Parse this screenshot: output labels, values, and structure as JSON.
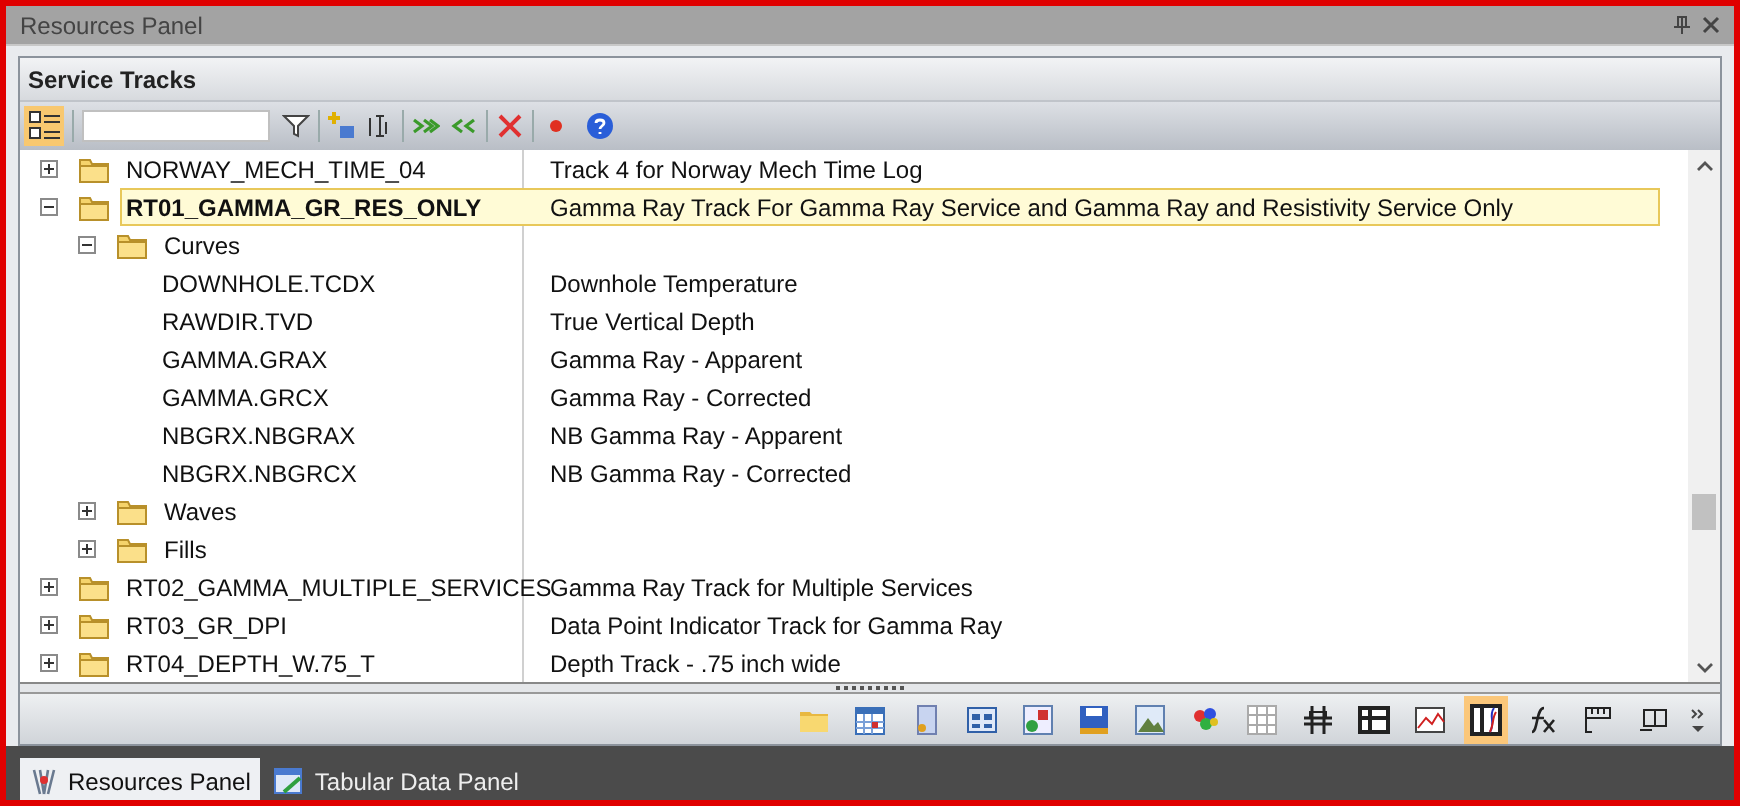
{
  "window": {
    "title": "Resources Panel"
  },
  "panel": {
    "title": "Service Tracks"
  },
  "tree": [
    {
      "kind": "folder",
      "name": "NORWAY_MECH_TIME_04",
      "description": "Track 4 for Norway Mech Time Log",
      "expanded": false,
      "selected": false
    },
    {
      "kind": "folder",
      "name": "RT01_GAMMA_GR_RES_ONLY",
      "description": "Gamma Ray Track For Gamma Ray Service and Gamma Ray and Resistivity Service Only",
      "expanded": true,
      "selected": true,
      "children": [
        {
          "kind": "folder",
          "name": "Curves",
          "expanded": true,
          "selected": false,
          "children": [
            {
              "kind": "leaf",
              "name": "DOWNHOLE.TCDX",
              "description": "Downhole Temperature",
              "selected": false
            },
            {
              "kind": "leaf",
              "name": "RAWDIR.TVD",
              "description": "True Vertical Depth",
              "selected": false
            },
            {
              "kind": "leaf",
              "name": "GAMMA.GRAX",
              "description": "Gamma Ray - Apparent",
              "selected": false
            },
            {
              "kind": "leaf",
              "name": "GAMMA.GRCX",
              "description": "Gamma Ray - Corrected",
              "selected": false
            },
            {
              "kind": "leaf",
              "name": "NBGRX.NBGRAX",
              "description": "NB Gamma Ray - Apparent",
              "selected": false
            },
            {
              "kind": "leaf",
              "name": "NBGRX.NBGRCX",
              "description": "NB Gamma Ray - Corrected",
              "selected": false
            }
          ]
        },
        {
          "kind": "folder",
          "name": "Waves",
          "expanded": false,
          "selected": false
        },
        {
          "kind": "folder",
          "name": "Fills",
          "expanded": false,
          "selected": false
        }
      ]
    },
    {
      "kind": "folder",
      "name": "RT02_GAMMA_MULTIPLE_SERVICES",
      "description": "Gamma Ray Track for Multiple Services",
      "expanded": false,
      "selected": false
    },
    {
      "kind": "folder",
      "name": "RT03_GR_DPI",
      "description": "Data Point Indicator Track for Gamma Ray",
      "expanded": false,
      "selected": false
    },
    {
      "kind": "folder",
      "name": "RT04_DEPTH_W.75_T",
      "description": "Depth Track - .75 inch wide",
      "expanded": false,
      "selected": false
    }
  ],
  "tools": [
    {
      "selected": false
    },
    {
      "selected": false
    },
    {
      "selected": false
    },
    {
      "selected": false
    },
    {
      "selected": false
    },
    {
      "selected": false
    },
    {
      "selected": false
    },
    {
      "selected": false
    },
    {
      "selected": false
    },
    {
      "selected": false
    },
    {
      "selected": false
    },
    {
      "selected": false
    },
    {
      "selected": true
    },
    {
      "selected": false
    },
    {
      "selected": false
    },
    {
      "selected": false
    }
  ],
  "tabs": [
    {
      "label": "Resources Panel",
      "selected": true
    },
    {
      "label": "Tabular Data Panel",
      "selected": false
    }
  ]
}
